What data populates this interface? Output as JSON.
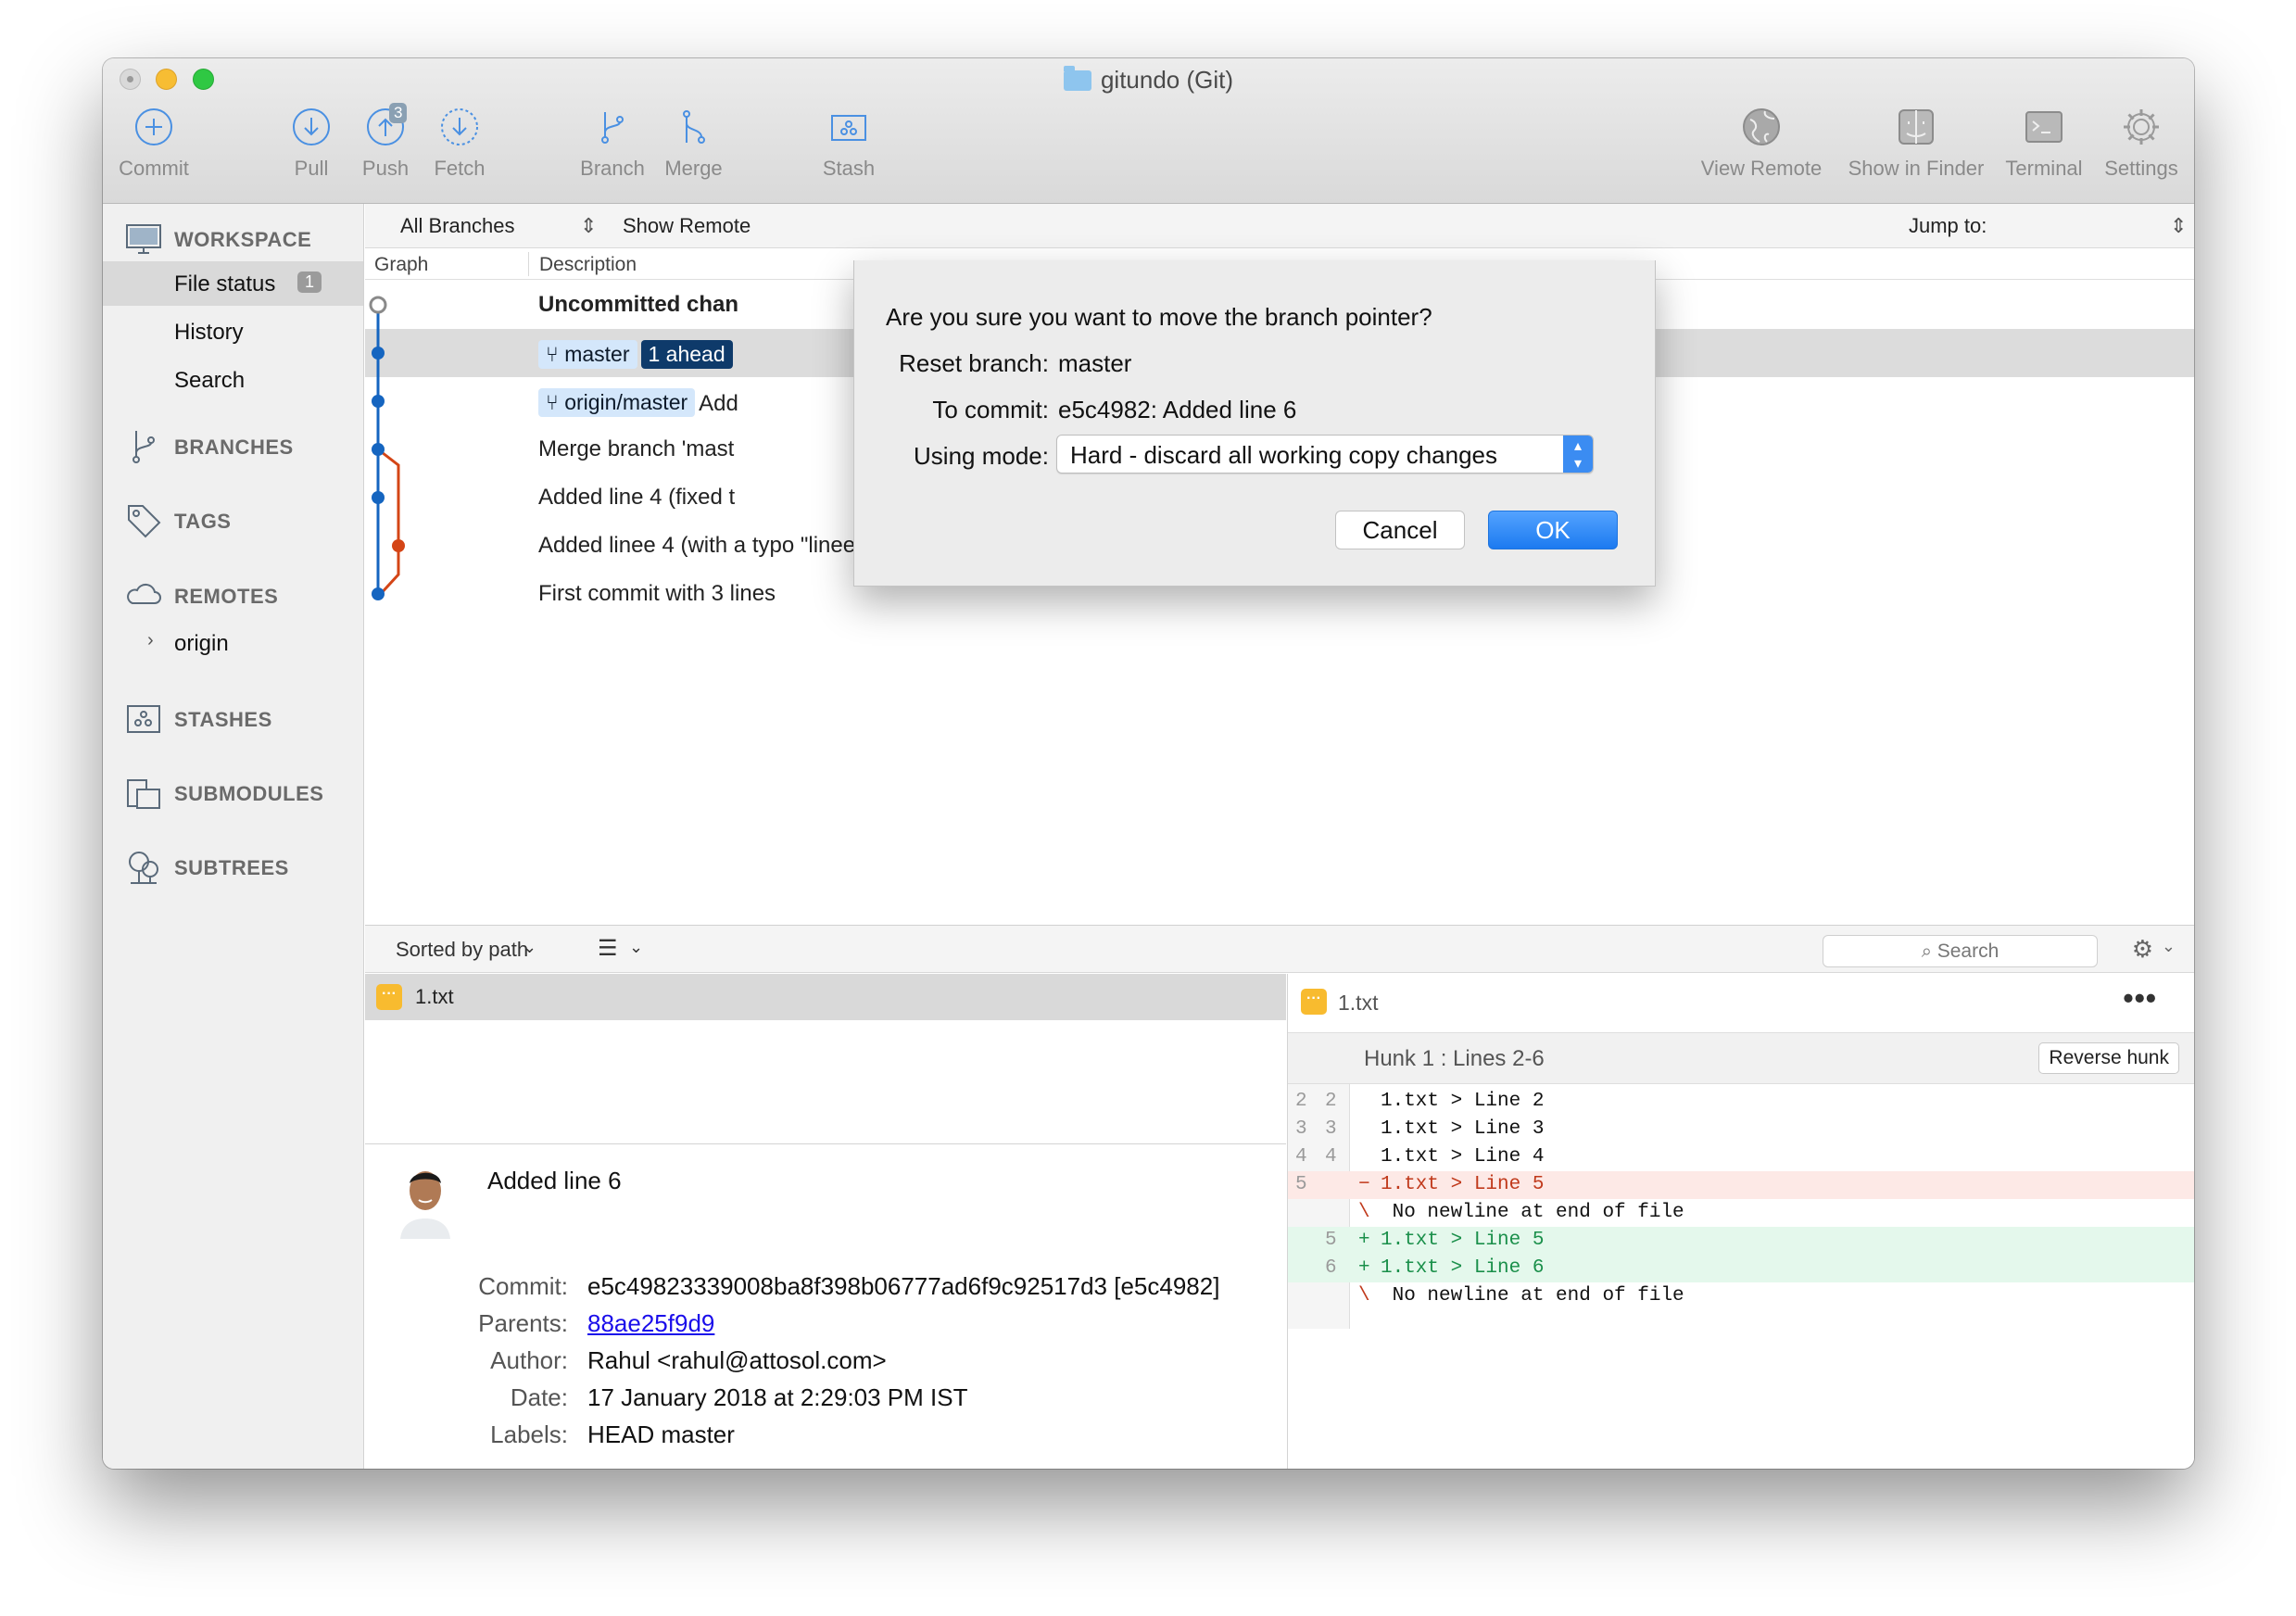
{
  "window": {
    "title": "gitundo (Git)"
  },
  "toolbar": {
    "commit": "Commit",
    "pull": "Pull",
    "push": "Push",
    "push_badge": "3",
    "fetch": "Fetch",
    "branch": "Branch",
    "merge": "Merge",
    "stash": "Stash",
    "view_remote": "View Remote",
    "show_in_finder": "Show in Finder",
    "terminal": "Terminal",
    "settings": "Settings"
  },
  "sidebar": {
    "workspace": "WORKSPACE",
    "file_status": "File status",
    "file_status_badge": "1",
    "history": "History",
    "search": "Search",
    "branches": "BRANCHES",
    "tags": "TAGS",
    "remotes": "REMOTES",
    "origin": "origin",
    "stashes": "STASHES",
    "submodules": "SUBMODULES",
    "subtrees": "SUBTREES"
  },
  "filterbar": {
    "all_branches": "All Branches",
    "show_remote": "Show Remote",
    "jump_to": "Jump to:"
  },
  "columns": {
    "graph": "Graph",
    "description": "Description"
  },
  "commits": [
    {
      "desc": "Uncommitted chan"
    },
    {
      "tag1": "master",
      "tag2": "1 ahead"
    },
    {
      "tag1": "origin/master",
      "desc": "Add"
    },
    {
      "desc": "Merge branch 'mast"
    },
    {
      "desc": "Added line 4 (fixed t"
    },
    {
      "desc": "Added linee 4 (with a typo \"linee\")"
    },
    {
      "desc": "First commit with 3 lines"
    }
  ],
  "files": {
    "sorted_by": "Sorted by path",
    "search_placeholder": "Search",
    "file_name": "1.txt",
    "file_icon_text": "···"
  },
  "commit_details": {
    "title": "Added line 6",
    "commit_label": "Commit:",
    "commit_value": "e5c49823339008ba8f398b06777ad6f9c92517d3 [e5c4982]",
    "parents_label": "Parents:",
    "parents_value": "88ae25f9d9",
    "author_label": "Author:",
    "author_value": "Rahul <rahul@attosol.com>",
    "date_label": "Date:",
    "date_value": "17 January 2018 at 2:29:03 PM IST",
    "labels_label": "Labels:",
    "labels_value": "HEAD master"
  },
  "diff": {
    "file_name": "1.txt",
    "more": "•••",
    "hunk_title": "Hunk 1 : Lines 2-6",
    "reverse_hunk": "Reverse hunk",
    "lines": [
      {
        "n1": "2",
        "n2": "2",
        "sign": "",
        "text": "1.txt > Line 2"
      },
      {
        "n1": "3",
        "n2": "3",
        "sign": "",
        "text": "1.txt > Line 3"
      },
      {
        "n1": "4",
        "n2": "4",
        "sign": "",
        "text": "1.txt > Line 4"
      },
      {
        "n1": "5",
        "n2": "",
        "sign": "−",
        "text": "1.txt > Line 5"
      },
      {
        "n1": "",
        "n2": "",
        "sign": "\\",
        "text": " No newline at end of file"
      },
      {
        "n1": "",
        "n2": "5",
        "sign": "+",
        "text": "1.txt > Line 5"
      },
      {
        "n1": "",
        "n2": "6",
        "sign": "+",
        "text": "1.txt > Line 6"
      },
      {
        "n1": "",
        "n2": "",
        "sign": "\\",
        "text": " No newline at end of file"
      }
    ]
  },
  "dialog": {
    "question": "Are you sure you want to move the branch pointer?",
    "reset_label": "Reset branch:",
    "reset_value": "master",
    "to_commit_label": "To commit:",
    "to_commit_value": "e5c4982: Added line 6",
    "mode_label": "Using mode:",
    "mode_value": "Hard - discard all working copy changes",
    "cancel": "Cancel",
    "ok": "OK"
  },
  "colors": {
    "accent": "#1c7af0",
    "graph_blue": "#1565c0",
    "graph_red": "#d44516",
    "ahead_badge": "#0e3a6a"
  }
}
